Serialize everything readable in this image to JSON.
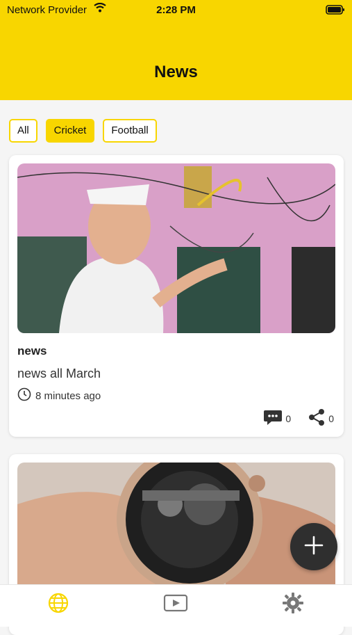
{
  "status_bar": {
    "carrier": "Network Provider",
    "time": "2:28 PM"
  },
  "header": {
    "title": "News"
  },
  "filters": {
    "items": [
      {
        "label": "All",
        "active": false
      },
      {
        "label": "Cricket",
        "active": true
      },
      {
        "label": "Football",
        "active": false
      }
    ]
  },
  "feed": {
    "cards": [
      {
        "title": "news",
        "subtitle": "news all March",
        "time": "8 minutes ago",
        "comments": "0",
        "shares": "0"
      }
    ]
  },
  "tabs": {
    "items": [
      {
        "icon": "globe-icon",
        "active": true
      },
      {
        "icon": "video-icon",
        "active": false
      },
      {
        "icon": "gear-icon",
        "active": false
      }
    ]
  },
  "colors": {
    "accent": "#f8d600",
    "fab": "#2f2f2f"
  }
}
